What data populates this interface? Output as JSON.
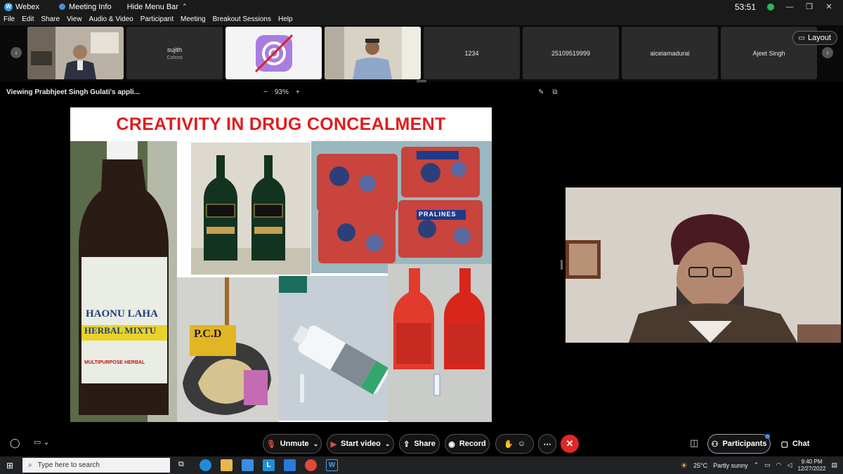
{
  "titlebar": {
    "app": "Webex",
    "meeting_info": "Meeting Info",
    "hide_menu": "Hide Menu Bar",
    "timer": "53:51"
  },
  "menu": [
    "File",
    "Edit",
    "Share",
    "View",
    "Audio & Video",
    "Participant",
    "Meeting",
    "Breakout Sessions",
    "Help"
  ],
  "participants": [
    {
      "name": "",
      "sub": "",
      "type": "video-office"
    },
    {
      "name": "sujith",
      "sub": "Cohost",
      "type": "name"
    },
    {
      "name": "",
      "sub": "",
      "type": "muted-cam"
    },
    {
      "name": "",
      "sub": "",
      "type": "video-man"
    },
    {
      "name": "1234",
      "sub": "",
      "type": "name"
    },
    {
      "name": "25109519999",
      "sub": "",
      "type": "name"
    },
    {
      "name": "aiceiamadurai",
      "sub": "",
      "type": "name"
    },
    {
      "name": "Ajeet Singh",
      "sub": "",
      "type": "name"
    }
  ],
  "layout_label": "Layout",
  "share": {
    "viewing": "Viewing Prabhjeet Singh Gulati's appli...",
    "zoom": "93%"
  },
  "slide": {
    "title": "CREATIVITY IN DRUG CONCEALMENT",
    "labels": {
      "bottle_text_1": "HAONU LAHA",
      "bottle_text_2": "HERBAL MIXTU",
      "bottle_text_3": "MULTIPURPOSE HERBAL",
      "pcd": "P.C.D",
      "pralines": "PRALINES"
    }
  },
  "controls": {
    "unmute": "Unmute",
    "start_video": "Start video",
    "share": "Share",
    "record": "Record",
    "participants": "Participants",
    "chat": "Chat"
  },
  "taskbar": {
    "search_placeholder": "Type here to search",
    "weather_temp": "25°C",
    "weather_desc": "Partly sunny",
    "time": "9:40 PM",
    "date": "12/27/2022"
  },
  "colors": {
    "title_red": "#e11c1c",
    "end_red": "#e02828",
    "webex_blue": "#2a9df4"
  }
}
